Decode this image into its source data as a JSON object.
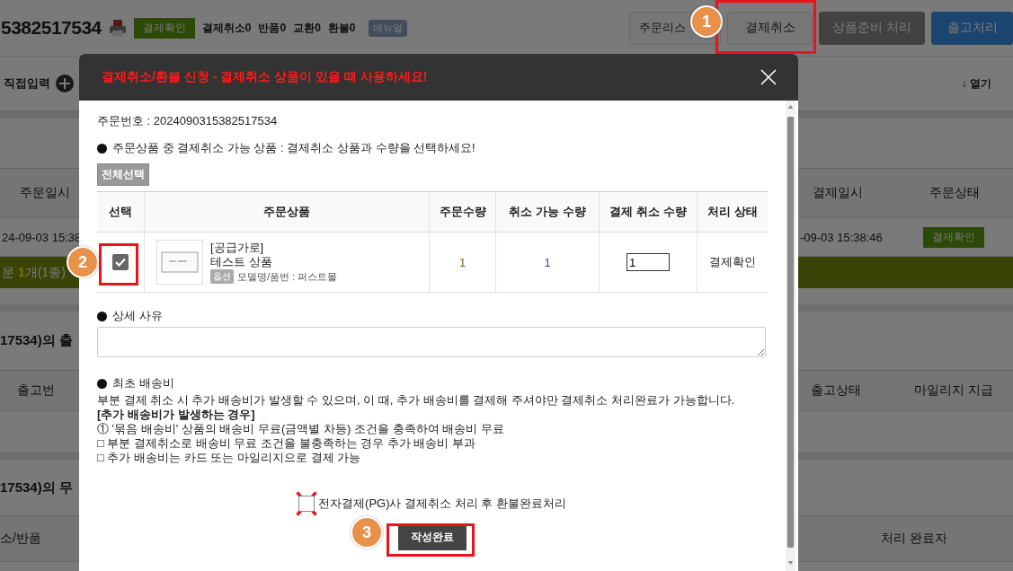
{
  "page": {
    "order_number": "5382517534",
    "status_badge": "결제확인",
    "counts": [
      "결제취소0",
      "반품0",
      "교환0",
      "환불0"
    ],
    "manual_tag": "매뉴얼",
    "actions": [
      {
        "label": "주문리스",
        "kind": "light"
      },
      {
        "label": "결제취소",
        "kind": "light"
      },
      {
        "label": "상품준비 처리",
        "kind": "dark"
      },
      {
        "label": "출고처리",
        "kind": "primary"
      }
    ],
    "direct_input": "직접입력",
    "open_toggle": "↓ 열기",
    "order_table": {
      "columns": [
        "주문일시",
        "결제일시",
        "주문상태"
      ],
      "ordered_at": "24-09-03 15:38",
      "paid_at": "-09-03 15:38:46",
      "status": "결제확인"
    },
    "summary_bar": "문 **1**개(1종)",
    "shipping_section": {
      "title": "17534)의 출",
      "columns": [
        "출고번",
        "출고상태",
        "마일리지 지급"
      ]
    },
    "void_section": {
      "title": "17534)의 무",
      "columns": [
        "소/반품",
        "처리 완료자"
      ]
    }
  },
  "dialog": {
    "title": "결제취소/환불 신청 - 결제취소 상품이 있을 때 사용하세요!",
    "order_no": "주문번호 : 2024090315382517534",
    "instruction": "주문상품 중 결제취소 가능 상품 : 결제취소 상품과 수량을 선택하세요!",
    "select_all": "전체선택",
    "columns": [
      "선택",
      "주문상품",
      "주문수량",
      "취소 가능 수량",
      "결제 취소 수량",
      "처리 상태"
    ],
    "items": [
      {
        "selected": true,
        "supplier": "[공급가로]",
        "name": "테스트 상품",
        "option_tag": "옵션",
        "option": "모델명/품번 : 퍼스트몰",
        "ordered_qty": "1",
        "cancelable_qty": "1",
        "cancel_qty": "1",
        "status": "결제확인"
      }
    ],
    "reason_label": "상세 사유",
    "shipping_label": "최초 배송비",
    "shipping_note": "부분 결제 취소 시 추가 배송비가 발생할 수 있으며, 이 때, 추가 배송비를 결제해 주셔야만 결제취소 처리완료가 가능합니다.",
    "cases_title": "[추가 배송비가 발생하는 경우]",
    "cases": [
      "① '묶음 배송비' 상품의 배송비 무료(금액별 차등) 조건을 충족하여 배송비 무료",
      "□ 부분 결제취소로 배송비 무료 조건을 불충족하는 경우 추가 배송비 부과",
      "□ 추가 배송비는 카드 또는 마일리지으로 결제 가능"
    ],
    "pg_option": {
      "label": "전자결제(PG)사 결제취소 처리 후 환불완료처리",
      "checked": false
    },
    "submit": "작성완료"
  },
  "annotations": [
    {
      "number": "1"
    },
    {
      "number": "2"
    },
    {
      "number": "3"
    }
  ]
}
